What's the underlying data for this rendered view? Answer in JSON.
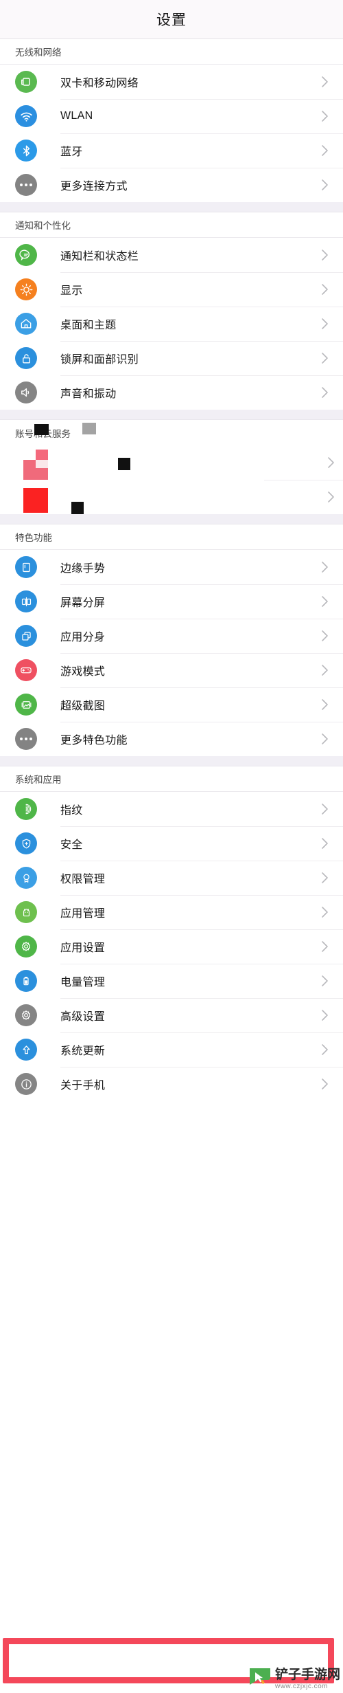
{
  "header": {
    "title": "设置"
  },
  "sections": [
    {
      "id": "wireless-network",
      "header": "无线和网络",
      "rows": [
        {
          "label": "双卡和移动网络",
          "icon": "sim-card-icon",
          "color": "#5ab950"
        },
        {
          "label": "WLAN",
          "icon": "wifi-icon",
          "color": "#2b8fe0"
        },
        {
          "label": "蓝牙",
          "icon": "bluetooth-icon",
          "color": "#2b9ae8"
        },
        {
          "label": "更多连接方式",
          "icon": "more-dots-icon",
          "color": "#838383"
        }
      ]
    },
    {
      "id": "notification-personalization",
      "header": "通知和个性化",
      "rows": [
        {
          "label": "通知栏和状态栏",
          "icon": "notification-bubble-icon",
          "color": "#4fb648"
        },
        {
          "label": "显示",
          "icon": "brightness-icon",
          "color": "#f5801f"
        },
        {
          "label": "桌面和主题",
          "icon": "home-icon",
          "color": "#3b9fe5"
        },
        {
          "label": "锁屏和面部识别",
          "icon": "lock-icon",
          "color": "#2b90dd"
        },
        {
          "label": "声音和振动",
          "icon": "speaker-icon",
          "color": "#858585"
        }
      ]
    },
    {
      "id": "account-cloud",
      "header": "账号和云服务",
      "corrupted": true,
      "rows": [
        {
          "label": "",
          "icon": "corrupted-icon",
          "color": "#f06071"
        },
        {
          "label": "",
          "icon": "corrupted-icon",
          "color": "#fa2a2a"
        }
      ]
    },
    {
      "id": "special-features",
      "header": "特色功能",
      "rows": [
        {
          "label": "边缘手势",
          "icon": "edge-gesture-icon",
          "color": "#2b90dd"
        },
        {
          "label": "屏幕分屏",
          "icon": "split-screen-icon",
          "color": "#2b90dd"
        },
        {
          "label": "应用分身",
          "icon": "app-clone-icon",
          "color": "#2b90dd"
        },
        {
          "label": "游戏模式",
          "icon": "gamepad-icon",
          "color": "#ef5061"
        },
        {
          "label": "超级截图",
          "icon": "screenshot-icon",
          "color": "#4fb648"
        },
        {
          "label": "更多特色功能",
          "icon": "more-dots-icon",
          "color": "#838383"
        }
      ]
    },
    {
      "id": "system-applications",
      "header": "系统和应用",
      "rows": [
        {
          "label": "指纹",
          "icon": "fingerprint-icon",
          "color": "#4fb648"
        },
        {
          "label": "安全",
          "icon": "shield-icon",
          "color": "#2b90dd"
        },
        {
          "label": "权限管理",
          "icon": "badge-icon",
          "color": "#3b9fe5"
        },
        {
          "label": "应用管理",
          "icon": "android-robot-icon",
          "color": "#6ec04e"
        },
        {
          "label": "应用设置",
          "icon": "gear-green-icon",
          "color": "#4fb648"
        },
        {
          "label": "电量管理",
          "icon": "battery-icon",
          "color": "#2b90dd"
        },
        {
          "label": "高级设置",
          "icon": "gear-gray-icon",
          "color": "#858585"
        },
        {
          "label": "系统更新",
          "icon": "update-arrow-icon",
          "color": "#2b90dd"
        },
        {
          "label": "关于手机",
          "icon": "info-icon",
          "color": "#858585",
          "highlighted": true
        }
      ]
    }
  ],
  "highlight": {
    "color": "#f4485a",
    "target_label": "关于手机"
  },
  "watermark": {
    "title": "铲子手游网",
    "url": "www.czjxjc.com"
  }
}
